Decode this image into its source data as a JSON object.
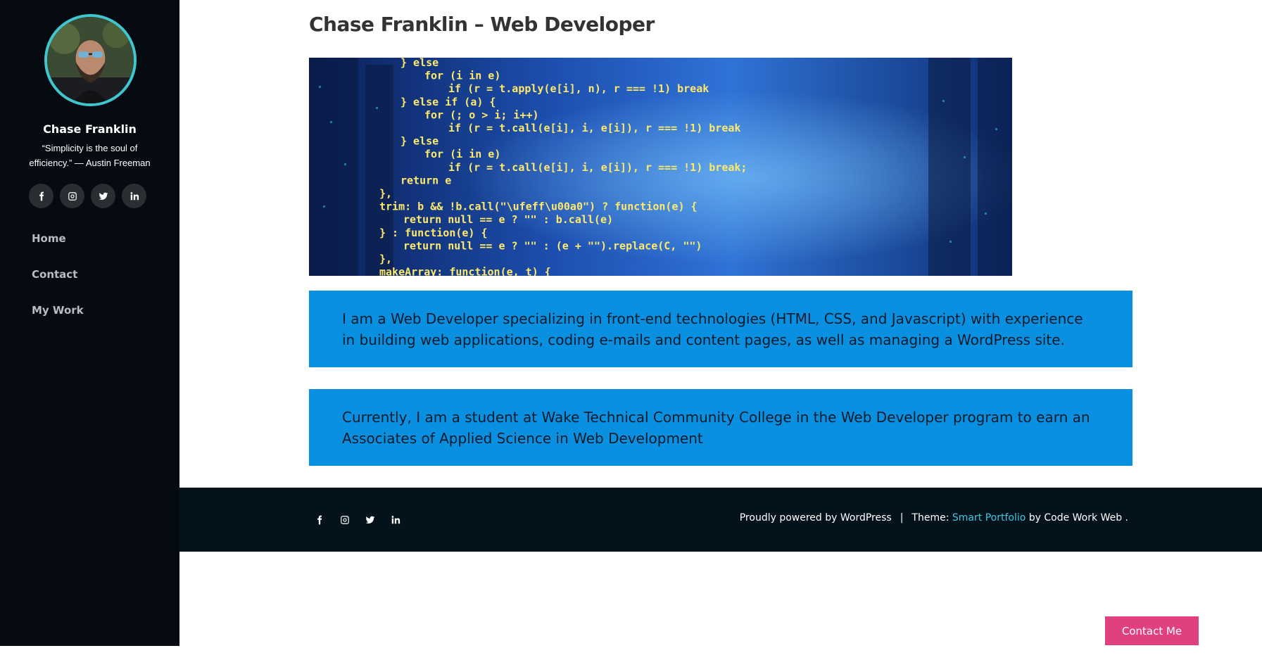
{
  "sidebar": {
    "author_name": "Chase Franklin",
    "quote": "“Simplicity is the soul of efficiency.” — Austin Freeman",
    "social_icons": [
      "facebook-icon",
      "instagram-icon",
      "twitter-icon",
      "linkedin-icon"
    ],
    "nav": [
      {
        "label": "Home"
      },
      {
        "label": "Contact"
      },
      {
        "label": "My Work"
      }
    ]
  },
  "main": {
    "title": "Chase Franklin – Web Developer",
    "hero_code": [
      "} else",
      "    for (i in e)",
      "        if (r = t.apply(e[i], n), r === !1) break",
      "} else if (a) {",
      "    for (; o > i; i++)",
      "        if (r = t.call(e[i], i, e[i]), r === !1) break",
      "} else",
      "    for (i in e)",
      "        if (r = t.call(e[i], i, e[i]), r === !1) break;",
      "return e",
      "},",
      "trim: b && !b.call(\"\\ufeff\\u00a0\") ? function(e) {",
      "    return null == e ? \"\" : b.call(e)",
      "} : function(e) {",
      "    return null == e ? \"\" : (e + \"\").replace(C, \"\")",
      "},",
      "makeArray: function(e, t) {"
    ],
    "box1_text": "I am a Web Developer specializing in front-end technologies (HTML, CSS, and Javascript) with experience in building web applications, coding e-mails and content pages, as well as managing a WordPress site.",
    "box2_text": "Currently, I am a student at Wake Technical Community College in the Web Developer program to earn an Associates of Applied Science in Web Development"
  },
  "footer": {
    "social_icons": [
      "facebook-icon",
      "instagram-icon",
      "twitter-icon",
      "linkedin-icon"
    ],
    "powered": "Proudly powered by WordPress",
    "separator": "|",
    "theme_prefix": "Theme:",
    "theme_name": "Smart Portfolio",
    "by_text": "by Code Work Web ."
  },
  "contact_button": "Contact Me",
  "colors": {
    "sidebar_bg": "#060b12",
    "accent_teal": "#3ec7cf",
    "info_box_bg": "#0a90e0",
    "footer_bg": "#04121c",
    "contact_button_bg": "#e0407f"
  }
}
